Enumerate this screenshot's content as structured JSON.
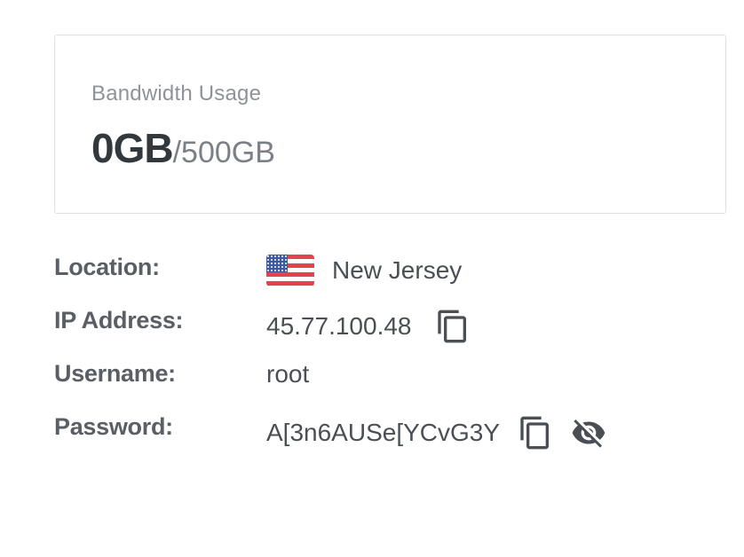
{
  "bandwidth": {
    "label": "Bandwidth Usage",
    "used": "0GB",
    "separator": "/",
    "total": "500GB"
  },
  "details": {
    "location": {
      "label": "Location:",
      "value": "New Jersey",
      "flag_icon": "us-flag-icon"
    },
    "ip_address": {
      "label": "IP Address:",
      "value": "45.77.100.48",
      "action_icon": "copy-icon"
    },
    "username": {
      "label": "Username:",
      "value": "root"
    },
    "password": {
      "label": "Password:",
      "value": "A[3n6AUSe[YCvG3Y",
      "action_icons": [
        "copy-icon",
        "eye-off-icon"
      ]
    }
  },
  "colors": {
    "text_primary": "#33383d",
    "text_secondary": "#8e9399",
    "border": "#dedfe1",
    "icon": "#4a4f55"
  }
}
